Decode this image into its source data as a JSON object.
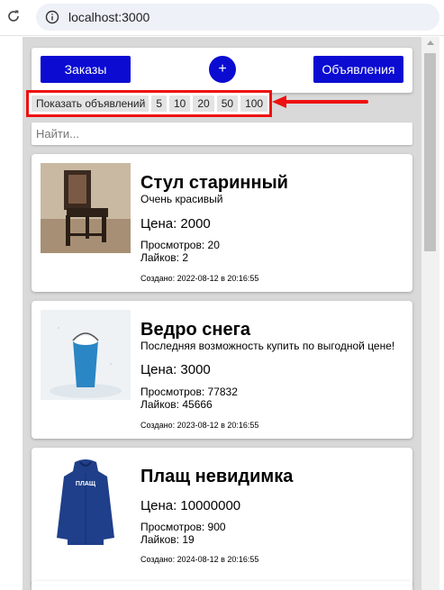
{
  "browser": {
    "url": "localhost:3000"
  },
  "header": {
    "orders_label": "Заказы",
    "add_label": "+",
    "ads_label": "Объявления"
  },
  "show_count": {
    "label": "Показать объявлений",
    "options": [
      "5",
      "10",
      "20",
      "50",
      "100"
    ]
  },
  "search": {
    "placeholder": "Найти..."
  },
  "listings": [
    {
      "title": "Стул старинный",
      "description": "Очень красивый",
      "price": "Цена: 2000",
      "views": "Просмотров: 20",
      "likes": "Лайков: 2",
      "created": "Создано: 2022-08-12 в 20:16:55"
    },
    {
      "title": "Ведро снега",
      "description": "Последняя возможность купить по выгодной цене!",
      "price": "Цена: 3000",
      "views": "Просмотров: 77832",
      "likes": "Лайков: 45666",
      "created": "Создано: 2023-08-12 в 20:16:55"
    },
    {
      "title": "Плащ невидимка",
      "description": "",
      "price": "Цена: 10000000",
      "views": "Просмотров: 900",
      "likes": "Лайков: 19",
      "created": "Создано: 2024-08-12 в 20:16:55",
      "image_text": "ПЛАЩ"
    }
  ],
  "colors": {
    "button_blue": "#0b0bd2",
    "highlight_red": "#ee1111",
    "page_bg": "#d9d9d9"
  }
}
